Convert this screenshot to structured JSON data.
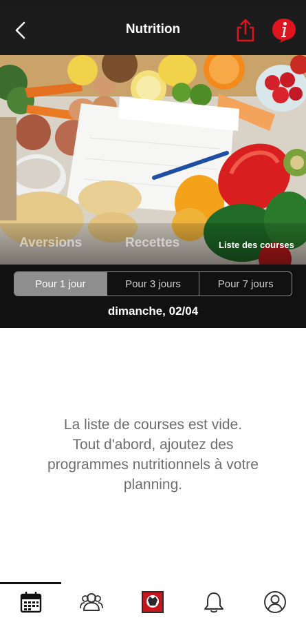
{
  "header": {
    "title": "Nutrition",
    "back_icon": "chevron-left-icon",
    "share_icon": "share-icon",
    "info_icon": "info-icon",
    "accent_color": "#e0141e"
  },
  "banner": {
    "tabs": [
      {
        "label": "Aversions",
        "active": false
      },
      {
        "label": "Recettes",
        "active": false
      },
      {
        "label": "Liste des courses",
        "active": true
      }
    ]
  },
  "period": {
    "options": [
      {
        "label": "Pour 1 jour",
        "active": true
      },
      {
        "label": "Pour 3 jours",
        "active": false
      },
      {
        "label": "Pour 7 jours",
        "active": false
      }
    ],
    "date": "dimanche, 02/04"
  },
  "content": {
    "empty_lines": [
      "La liste de courses est vide.",
      "Tout d'abord, ajoutez des",
      "programmes nutritionnels à votre",
      "planning."
    ]
  },
  "tabbar": {
    "items": [
      {
        "icon": "calendar-icon",
        "active": true
      },
      {
        "icon": "users-icon",
        "active": false
      },
      {
        "icon": "club-logo-icon",
        "active": false
      },
      {
        "icon": "bell-icon",
        "active": false
      },
      {
        "icon": "profile-icon",
        "active": false
      }
    ]
  }
}
